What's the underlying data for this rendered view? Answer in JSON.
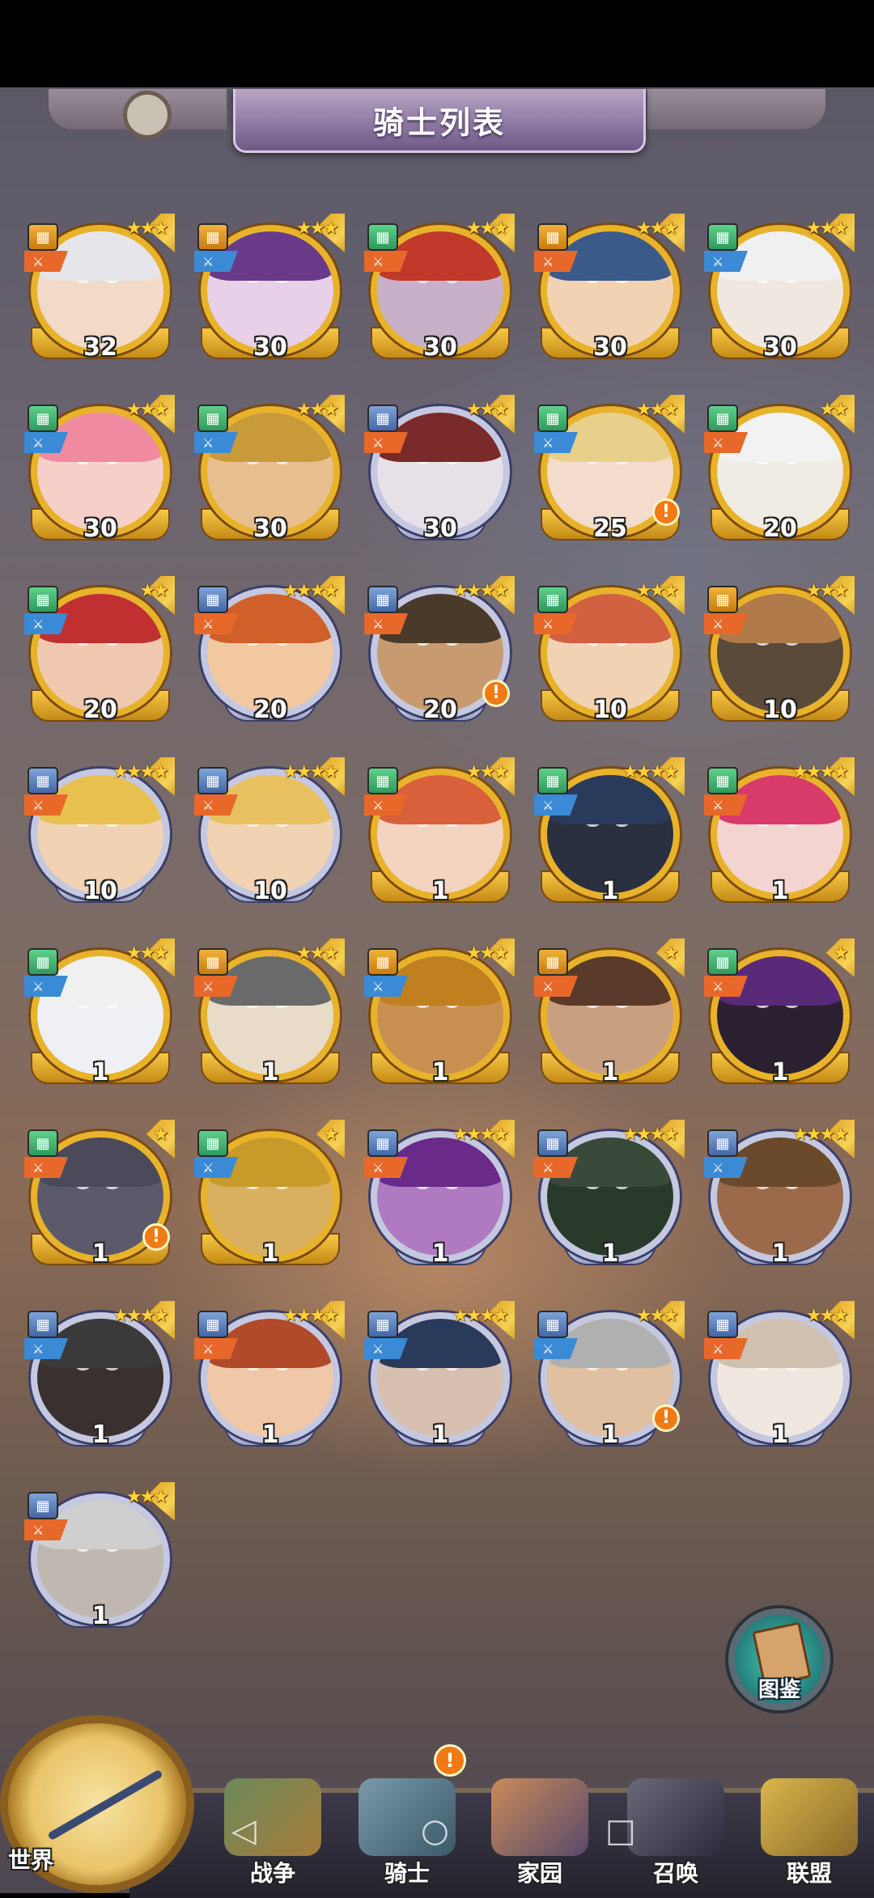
{
  "title": "骑士列表",
  "codex_label": "图鉴",
  "nav": {
    "world": "世界",
    "battle": "战争",
    "knights": "骑士",
    "home": "家园",
    "summon": "召唤",
    "alliance": "联盟",
    "knights_alert": "!"
  },
  "alert_symbol": "!",
  "colors": {
    "gold_frame": "#e8b32a",
    "silver_frame": "#c4c8e0",
    "alert": "#f07a14",
    "title_plate": "#8f7aa4"
  },
  "knights": [
    {
      "level": "32",
      "stars": "★★★",
      "frame": "gold",
      "cls": "gold",
      "role": "orange",
      "alert": false
    },
    {
      "level": "30",
      "stars": "★★★",
      "frame": "gold",
      "cls": "gold",
      "role": "blue",
      "alert": false
    },
    {
      "level": "30",
      "stars": "★★★",
      "frame": "gold",
      "cls": "green",
      "role": "orange",
      "alert": false
    },
    {
      "level": "30",
      "stars": "★★★",
      "frame": "gold",
      "cls": "gold",
      "role": "orange",
      "alert": false
    },
    {
      "level": "30",
      "stars": "★★★",
      "frame": "gold",
      "cls": "green",
      "role": "blue",
      "alert": false
    },
    {
      "level": "30",
      "stars": "★★★",
      "frame": "gold",
      "cls": "green",
      "role": "blue",
      "alert": false
    },
    {
      "level": "30",
      "stars": "★★★",
      "frame": "gold",
      "cls": "green",
      "role": "blue",
      "alert": false
    },
    {
      "level": "30",
      "stars": "★★★",
      "frame": "silver",
      "cls": "blue",
      "role": "orange",
      "alert": false
    },
    {
      "level": "25",
      "stars": "★★★",
      "frame": "gold",
      "cls": "green",
      "role": "blue",
      "alert": true
    },
    {
      "level": "20",
      "stars": "★★",
      "frame": "gold",
      "cls": "green",
      "role": "orange",
      "alert": false
    },
    {
      "level": "20",
      "stars": "★★",
      "frame": "gold",
      "cls": "green",
      "role": "blue",
      "alert": false
    },
    {
      "level": "20",
      "stars": "★★★★",
      "frame": "silver",
      "cls": "blue",
      "role": "orange",
      "alert": false
    },
    {
      "level": "20",
      "stars": "★★★★",
      "frame": "silver",
      "cls": "blue",
      "role": "orange",
      "alert": true
    },
    {
      "level": "10",
      "stars": "★★★",
      "frame": "gold",
      "cls": "green",
      "role": "orange",
      "alert": false
    },
    {
      "level": "10",
      "stars": "★★★",
      "frame": "gold",
      "cls": "gold",
      "role": "orange",
      "alert": false
    },
    {
      "level": "10",
      "stars": "★★★★",
      "frame": "silver",
      "cls": "blue",
      "role": "orange",
      "alert": false
    },
    {
      "level": "10",
      "stars": "★★★★",
      "frame": "silver",
      "cls": "blue",
      "role": "orange",
      "alert": false
    },
    {
      "level": "1",
      "stars": "★★★",
      "frame": "gold",
      "cls": "green",
      "role": "orange",
      "alert": false
    },
    {
      "level": "1",
      "stars": "★★★★",
      "frame": "gold",
      "cls": "green",
      "role": "blue",
      "alert": false
    },
    {
      "level": "1",
      "stars": "★★★★",
      "frame": "gold",
      "cls": "green",
      "role": "orange",
      "alert": false
    },
    {
      "level": "1",
      "stars": "★★★",
      "frame": "gold",
      "cls": "green",
      "role": "blue",
      "alert": false
    },
    {
      "level": "1",
      "stars": "★★★",
      "frame": "gold",
      "cls": "gold",
      "role": "orange",
      "alert": false
    },
    {
      "level": "1",
      "stars": "★★★",
      "frame": "gold",
      "cls": "gold",
      "role": "blue",
      "alert": false
    },
    {
      "level": "1",
      "stars": "★",
      "frame": "gold",
      "cls": "gold",
      "role": "orange",
      "alert": false
    },
    {
      "level": "1",
      "stars": "★",
      "frame": "gold",
      "cls": "green",
      "role": "orange",
      "alert": false
    },
    {
      "level": "1",
      "stars": "★",
      "frame": "gold",
      "cls": "green",
      "role": "orange",
      "alert": true
    },
    {
      "level": "1",
      "stars": "★",
      "frame": "gold",
      "cls": "green",
      "role": "blue",
      "alert": false
    },
    {
      "level": "1",
      "stars": "★★★★",
      "frame": "silver",
      "cls": "blue",
      "role": "orange",
      "alert": false
    },
    {
      "level": "1",
      "stars": "★★★★",
      "frame": "silver",
      "cls": "blue",
      "role": "orange",
      "alert": false
    },
    {
      "level": "1",
      "stars": "★★★★",
      "frame": "silver",
      "cls": "blue",
      "role": "blue",
      "alert": false
    },
    {
      "level": "1",
      "stars": "★★★★",
      "frame": "silver",
      "cls": "blue",
      "role": "blue",
      "alert": false
    },
    {
      "level": "1",
      "stars": "★★★★",
      "frame": "silver",
      "cls": "blue",
      "role": "orange",
      "alert": false
    },
    {
      "level": "1",
      "stars": "★★★★",
      "frame": "silver",
      "cls": "blue",
      "role": "blue",
      "alert": false
    },
    {
      "level": "1",
      "stars": "★★★",
      "frame": "silver",
      "cls": "blue",
      "role": "blue",
      "alert": true
    },
    {
      "level": "1",
      "stars": "★★★",
      "frame": "silver",
      "cls": "blue",
      "role": "orange",
      "alert": false
    },
    {
      "level": "1",
      "stars": "★★★",
      "frame": "silver",
      "cls": "blue",
      "role": "orange",
      "alert": false
    }
  ]
}
